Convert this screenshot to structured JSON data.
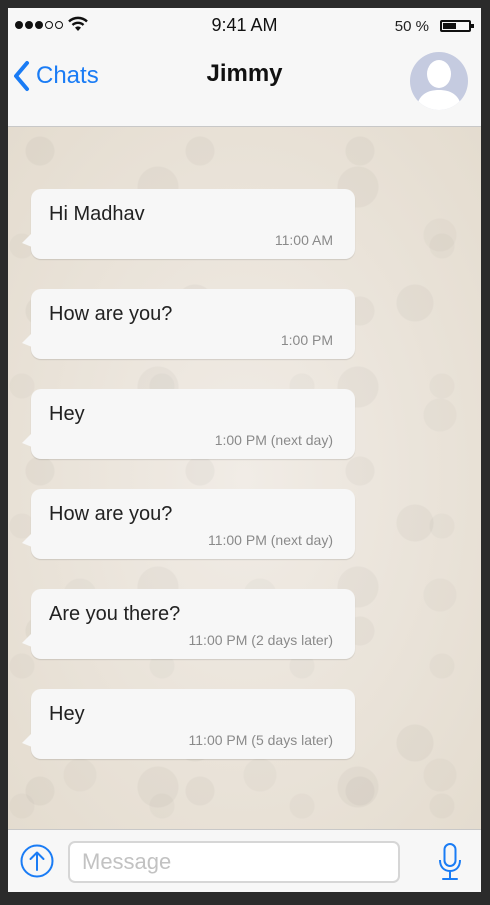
{
  "status_bar": {
    "time": "9:41 AM",
    "battery_percent": "50 %",
    "battery_level": 0.5,
    "signal_bars": 5,
    "signal_filled": 3
  },
  "nav": {
    "back_label": "Chats",
    "contact_name": "Jimmy"
  },
  "messages": [
    {
      "text": "Hi Madhav",
      "time": "11:00 AM"
    },
    {
      "text": "How are you?",
      "time": "1:00 PM"
    },
    {
      "text": "Hey",
      "time": "1:00 PM (next day)"
    },
    {
      "text": "How are you?",
      "time": "11:00 PM (next day)"
    },
    {
      "text": "Are you there?",
      "time": "11:00 PM (2 days later)"
    },
    {
      "text": "Hey",
      "time": "11:00 PM (5 days later)"
    }
  ],
  "composer": {
    "placeholder": "Message"
  },
  "colors": {
    "accent": "#1a7cf5",
    "bubble": "#f7f7f7",
    "chat_background": "#e8e1d8",
    "avatar": "#c5cbe0"
  },
  "icons": {
    "back": "chevron-left-icon",
    "attach": "arrow-up-circle-icon",
    "mic": "microphone-icon",
    "wifi": "wifi-icon",
    "battery": "battery-icon",
    "avatar": "person-silhouette-icon"
  }
}
